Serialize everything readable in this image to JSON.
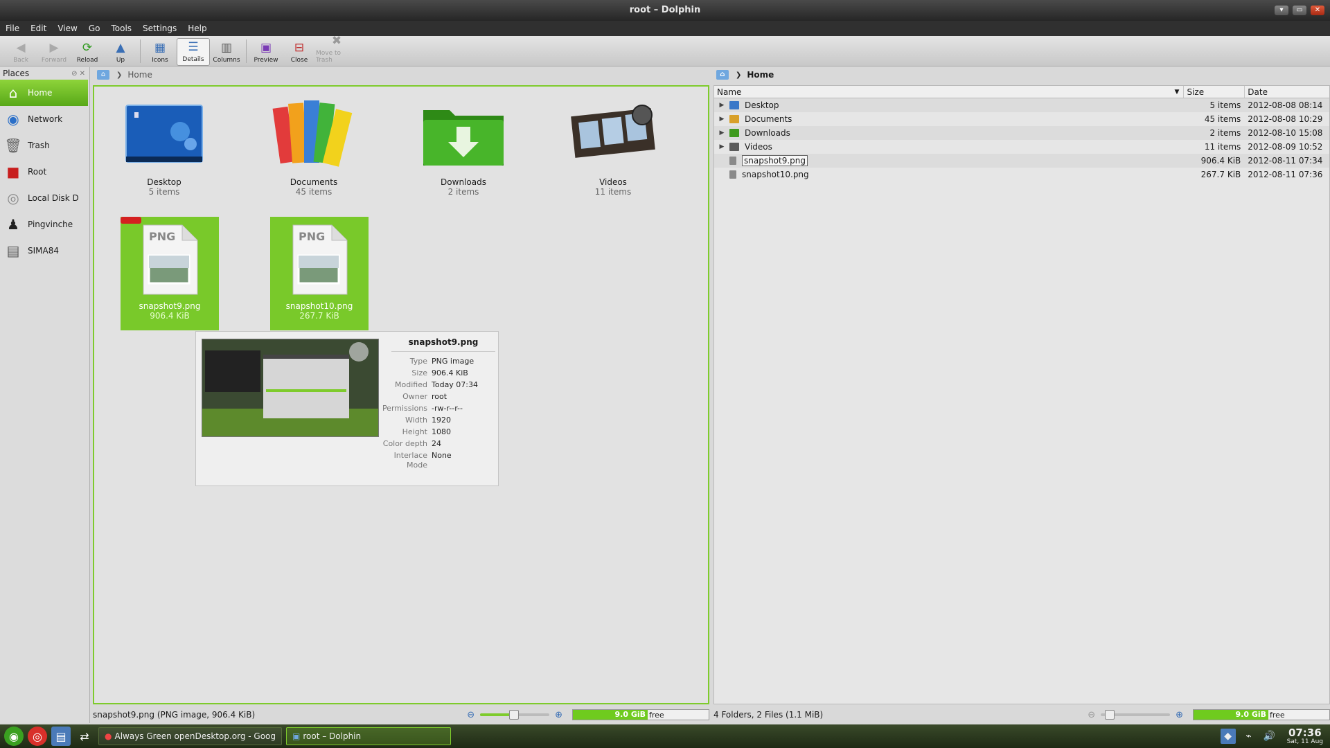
{
  "window": {
    "title": "root – Dolphin",
    "controls": [
      "▾",
      "▭",
      "✕"
    ]
  },
  "menu": [
    "File",
    "Edit",
    "View",
    "Go",
    "Tools",
    "Settings",
    "Help"
  ],
  "toolbar": {
    "back": "Back",
    "forward": "Forward",
    "reload": "Reload",
    "up": "Up",
    "icons": "Icons",
    "details": "Details",
    "columns": "Columns",
    "preview": "Preview",
    "close": "Close",
    "move_to_trash": "Move to Trash"
  },
  "places": {
    "title": "Places",
    "items": [
      {
        "label": "Home",
        "selected": true
      },
      {
        "label": "Network"
      },
      {
        "label": "Trash"
      },
      {
        "label": "Root"
      },
      {
        "label": "Local Disk D"
      },
      {
        "label": "Pingvinche"
      },
      {
        "label": "SIMA84"
      }
    ]
  },
  "left": {
    "breadcrumb": "Home",
    "items": [
      {
        "name": "Desktop",
        "count": "5 items"
      },
      {
        "name": "Documents",
        "count": "45 items"
      },
      {
        "name": "Downloads",
        "count": "2 items"
      },
      {
        "name": "Videos",
        "count": "11 items"
      },
      {
        "name": "snapshot9.png",
        "count": "906.4 KiB"
      },
      {
        "name": "snapshot10.png",
        "count": "267.7 KiB"
      }
    ],
    "tooltip": {
      "title": "snapshot9.png",
      "rows": [
        {
          "k": "Type",
          "v": "PNG image"
        },
        {
          "k": "Size",
          "v": "906.4 KiB"
        },
        {
          "k": "Modified",
          "v": "Today 07:34"
        },
        {
          "k": "Owner",
          "v": "root"
        },
        {
          "k": "Permissions",
          "v": "-rw-r--r--"
        },
        {
          "k": "Width",
          "v": "1920"
        },
        {
          "k": "Height",
          "v": "1080"
        },
        {
          "k": "Color depth",
          "v": "24"
        },
        {
          "k": "Interlace Mode",
          "v": "None"
        }
      ]
    },
    "status": "snapshot9.png (PNG image, 906.4 KiB)",
    "free_space": "9.0 GiB",
    "free_label": "free"
  },
  "right": {
    "breadcrumb": "Home",
    "columns": {
      "name": "Name",
      "size": "Size",
      "date": "Date"
    },
    "rows": [
      {
        "name": "Desktop",
        "size": "5 items",
        "date": "2012-08-08 08:14",
        "folder": true,
        "color": "#3b78c8"
      },
      {
        "name": "Documents",
        "size": "45 items",
        "date": "2012-08-08 10:29",
        "folder": true,
        "color": "#d8a02a"
      },
      {
        "name": "Downloads",
        "size": "2 items",
        "date": "2012-08-10 15:08",
        "folder": true,
        "color": "#3f9a1e"
      },
      {
        "name": "Videos",
        "size": "11 items",
        "date": "2012-08-09 10:52",
        "folder": true,
        "color": "#5b5b5b"
      },
      {
        "name": "snapshot9.png",
        "size": "906.4 KiB",
        "date": "2012-08-11 07:34",
        "editing": true,
        "color": "#8a8a8a"
      },
      {
        "name": "snapshot10.png",
        "size": "267.7 KiB",
        "date": "2012-08-11 07:36",
        "color": "#8a8a8a"
      }
    ],
    "status": "4 Folders, 2 Files (1.1 MiB)",
    "free_space": "9.0 GiB",
    "free_label": "free"
  },
  "taskbar": {
    "tasks": [
      {
        "label": "Always Green openDesktop.org - Goog"
      },
      {
        "label": "root – Dolphin",
        "active": true
      }
    ],
    "time": "07:36",
    "date": "Sat, 11 Aug"
  },
  "colors": {
    "accent": "#7ecb2c",
    "titlebar": "#2d2d2d"
  }
}
